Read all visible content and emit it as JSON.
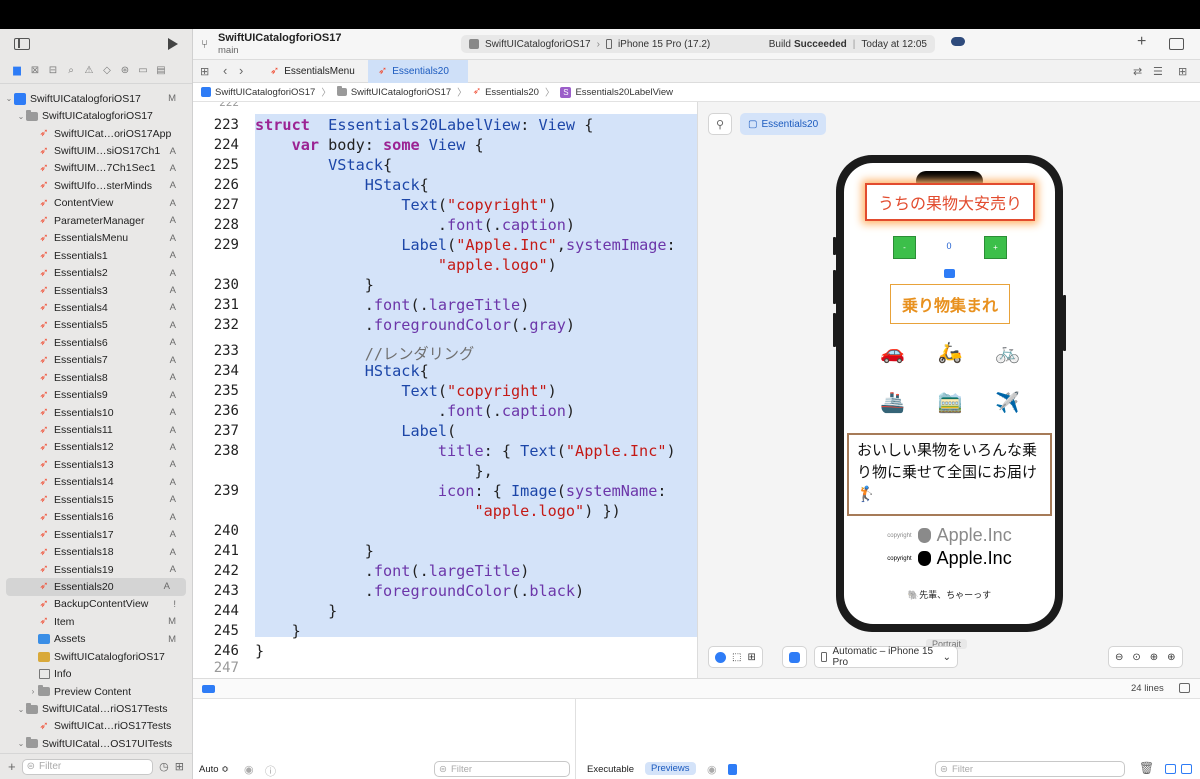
{
  "project": {
    "name": "SwiftUICatalogforiOS17",
    "branch": "main"
  },
  "toolbar": {
    "scheme": "SwiftUICatalogforiOS17",
    "device": "iPhone 15 Pro (17.2)",
    "build_prefix": "Build",
    "build_status": "Succeeded",
    "build_time": "Today at 12:05"
  },
  "tabs": [
    {
      "label": "EssentialsMenu"
    },
    {
      "label": "Essentials20"
    }
  ],
  "jumpbar": [
    "SwiftUICatalogforiOS17",
    "SwiftUICatalogforiOS17",
    "Essentials20",
    "Essentials20LabelView"
  ],
  "navigator": {
    "rows": [
      {
        "label": "SwiftUICatalogforiOS17",
        "status": "M",
        "kind": "project",
        "indent": 0,
        "open": true
      },
      {
        "label": "SwiftUICatalogforiOS17",
        "status": "",
        "kind": "folder",
        "indent": 1,
        "open": true
      },
      {
        "label": "SwiftUICat…oriOS17App",
        "status": "",
        "kind": "swift",
        "indent": 2
      },
      {
        "label": "SwiftUIM…siOS17Ch1",
        "status": "A",
        "kind": "swift",
        "indent": 2
      },
      {
        "label": "SwiftUIM…7Ch1Sec1",
        "status": "A",
        "kind": "swift",
        "indent": 2
      },
      {
        "label": "SwiftUIfo…sterMinds",
        "status": "A",
        "kind": "swift",
        "indent": 2
      },
      {
        "label": "ContentView",
        "status": "A",
        "kind": "swift",
        "indent": 2
      },
      {
        "label": "ParameterManager",
        "status": "A",
        "kind": "swift",
        "indent": 2
      },
      {
        "label": "EssentialsMenu",
        "status": "A",
        "kind": "swift",
        "indent": 2
      },
      {
        "label": "Essentials1",
        "status": "A",
        "kind": "swift",
        "indent": 2
      },
      {
        "label": "Essentials2",
        "status": "A",
        "kind": "swift",
        "indent": 2
      },
      {
        "label": "Essentials3",
        "status": "A",
        "kind": "swift",
        "indent": 2
      },
      {
        "label": "Essentials4",
        "status": "A",
        "kind": "swift",
        "indent": 2
      },
      {
        "label": "Essentials5",
        "status": "A",
        "kind": "swift",
        "indent": 2
      },
      {
        "label": "Essentials6",
        "status": "A",
        "kind": "swift",
        "indent": 2
      },
      {
        "label": "Essentials7",
        "status": "A",
        "kind": "swift",
        "indent": 2
      },
      {
        "label": "Essentials8",
        "status": "A",
        "kind": "swift",
        "indent": 2
      },
      {
        "label": "Essentials9",
        "status": "A",
        "kind": "swift",
        "indent": 2
      },
      {
        "label": "Essentials10",
        "status": "A",
        "kind": "swift",
        "indent": 2
      },
      {
        "label": "Essentials11",
        "status": "A",
        "kind": "swift",
        "indent": 2
      },
      {
        "label": "Essentials12",
        "status": "A",
        "kind": "swift",
        "indent": 2
      },
      {
        "label": "Essentials13",
        "status": "A",
        "kind": "swift",
        "indent": 2
      },
      {
        "label": "Essentials14",
        "status": "A",
        "kind": "swift",
        "indent": 2
      },
      {
        "label": "Essentials15",
        "status": "A",
        "kind": "swift",
        "indent": 2
      },
      {
        "label": "Essentials16",
        "status": "A",
        "kind": "swift",
        "indent": 2
      },
      {
        "label": "Essentials17",
        "status": "A",
        "kind": "swift",
        "indent": 2
      },
      {
        "label": "Essentials18",
        "status": "A",
        "kind": "swift",
        "indent": 2
      },
      {
        "label": "Essentials19",
        "status": "A",
        "kind": "swift",
        "indent": 2
      },
      {
        "label": "Essentials20",
        "status": "A",
        "kind": "swift",
        "indent": 2,
        "selected": true
      },
      {
        "label": "BackupContentView",
        "status": "!",
        "kind": "swift",
        "indent": 2
      },
      {
        "label": "Item",
        "status": "M",
        "kind": "swift",
        "indent": 2
      },
      {
        "label": "Assets",
        "status": "M",
        "kind": "assets",
        "indent": 2
      },
      {
        "label": "SwiftUICatalogforiOS17",
        "status": "",
        "kind": "entitlements",
        "indent": 2
      },
      {
        "label": "Info",
        "status": "",
        "kind": "plist",
        "indent": 2
      },
      {
        "label": "Preview Content",
        "status": "",
        "kind": "folder",
        "indent": 2,
        "open": false
      },
      {
        "label": "SwiftUICatal…riOS17Tests",
        "status": "",
        "kind": "folder",
        "indent": 1,
        "open": true
      },
      {
        "label": "SwiftUICat…riOS17Tests",
        "status": "",
        "kind": "swift",
        "indent": 2
      },
      {
        "label": "SwiftUICatal…OS17UITests",
        "status": "",
        "kind": "folder",
        "indent": 1,
        "open": true
      }
    ],
    "filter_placeholder": "Filter"
  },
  "code": {
    "partial_line": "222",
    "last_line": "247",
    "lines": [
      {
        "n": "223",
        "segs": [
          [
            "kw",
            "struct"
          ],
          [
            "",
            "  "
          ],
          [
            "ty",
            "Essentials20LabelView"
          ],
          [
            "",
            ": "
          ],
          [
            "ty",
            "View"
          ],
          [
            "",
            " {"
          ]
        ]
      },
      {
        "n": "224",
        "segs": [
          [
            "",
            "    "
          ],
          [
            "kw",
            "var"
          ],
          [
            "",
            ""
          ],
          [
            "",
            " body: "
          ],
          [
            "kw",
            "some"
          ],
          [
            "",
            " "
          ],
          [
            "ty",
            "View"
          ],
          [
            "",
            " {"
          ]
        ]
      },
      {
        "n": "225",
        "segs": [
          [
            "",
            "        "
          ],
          [
            "ty",
            "VStack"
          ],
          [
            "",
            "{"
          ]
        ]
      },
      {
        "n": "226",
        "segs": [
          [
            "",
            "            "
          ],
          [
            "ty",
            "HStack"
          ],
          [
            "",
            "{"
          ]
        ]
      },
      {
        "n": "227",
        "segs": [
          [
            "",
            "                "
          ],
          [
            "ty",
            "Text"
          ],
          [
            "",
            "("
          ],
          [
            "str",
            "\"copyright\""
          ],
          [
            "",
            ")"
          ]
        ]
      },
      {
        "n": "228",
        "segs": [
          [
            "",
            "                    ."
          ],
          [
            "fn",
            "font"
          ],
          [
            "",
            "(."
          ],
          [
            "fn",
            "caption"
          ],
          [
            "",
            ")"
          ]
        ]
      },
      {
        "n": "229",
        "segs": [
          [
            "",
            "                "
          ],
          [
            "ty",
            "Label"
          ],
          [
            "",
            "("
          ],
          [
            "str",
            "\"Apple.Inc\""
          ],
          [
            "",
            ","
          ],
          [
            "fn",
            "systemImage"
          ],
          [
            "",
            ":"
          ]
        ]
      },
      {
        "n": "",
        "segs": [
          [
            "",
            "                    "
          ],
          [
            "str",
            "\"apple.logo\""
          ],
          [
            "",
            ")"
          ]
        ]
      },
      {
        "n": "230",
        "segs": [
          [
            "",
            "            }"
          ]
        ]
      },
      {
        "n": "231",
        "segs": [
          [
            "",
            "            ."
          ],
          [
            "fn",
            "font"
          ],
          [
            "",
            "(."
          ],
          [
            "fn",
            "largeTitle"
          ],
          [
            "",
            ")"
          ]
        ]
      },
      {
        "n": "232",
        "segs": [
          [
            "",
            "            ."
          ],
          [
            "fn",
            "foregroundColor"
          ],
          [
            "",
            "(."
          ],
          [
            "fn",
            "gray"
          ],
          [
            "",
            ")"
          ]
        ]
      },
      {
        "n": "233",
        "segs": [
          [
            "cm",
            "            //レンダリング"
          ]
        ]
      },
      {
        "n": "234",
        "segs": [
          [
            "",
            "            "
          ],
          [
            "ty",
            "HStack"
          ],
          [
            "",
            "{"
          ]
        ]
      },
      {
        "n": "235",
        "segs": [
          [
            "",
            "                "
          ],
          [
            "ty",
            "Text"
          ],
          [
            "",
            "("
          ],
          [
            "str",
            "\"copyright\""
          ],
          [
            "",
            ")"
          ]
        ]
      },
      {
        "n": "236",
        "segs": [
          [
            "",
            "                    ."
          ],
          [
            "fn",
            "font"
          ],
          [
            "",
            "(."
          ],
          [
            "fn",
            "caption"
          ],
          [
            "",
            ")"
          ]
        ]
      },
      {
        "n": "237",
        "segs": [
          [
            "",
            "                "
          ],
          [
            "ty",
            "Label"
          ],
          [
            "",
            "("
          ]
        ]
      },
      {
        "n": "238",
        "segs": [
          [
            "",
            "                    "
          ],
          [
            "fn",
            "title"
          ],
          [
            "",
            ": { "
          ],
          [
            "ty",
            "Text"
          ],
          [
            "",
            "("
          ],
          [
            "str",
            "\"Apple.Inc\""
          ],
          [
            "",
            ")"
          ]
        ]
      },
      {
        "n": "",
        "segs": [
          [
            "",
            "                        },"
          ]
        ]
      },
      {
        "n": "239",
        "segs": [
          [
            "",
            "                    "
          ],
          [
            "fn",
            "icon"
          ],
          [
            "",
            ": { "
          ],
          [
            "ty",
            "Image"
          ],
          [
            "",
            "("
          ],
          [
            "fn",
            "systemName"
          ],
          [
            "",
            ":"
          ]
        ]
      },
      {
        "n": "",
        "segs": [
          [
            "",
            "                        "
          ],
          [
            "str",
            "\"apple.logo\""
          ],
          [
            "",
            ") })"
          ]
        ]
      },
      {
        "n": "240",
        "segs": [
          [
            "",
            ""
          ]
        ]
      },
      {
        "n": "241",
        "segs": [
          [
            "",
            "            }"
          ]
        ]
      },
      {
        "n": "242",
        "segs": [
          [
            "",
            "            ."
          ],
          [
            "fn",
            "font"
          ],
          [
            "",
            "(."
          ],
          [
            "fn",
            "largeTitle"
          ],
          [
            "",
            ")"
          ]
        ]
      },
      {
        "n": "243",
        "segs": [
          [
            "",
            "            ."
          ],
          [
            "fn",
            "foregroundColor"
          ],
          [
            "",
            "(."
          ],
          [
            "fn",
            "black"
          ],
          [
            "",
            ")"
          ]
        ]
      },
      {
        "n": "244",
        "segs": [
          [
            "",
            "        }"
          ]
        ]
      },
      {
        "n": "245",
        "segs": [
          [
            "",
            "    }"
          ]
        ]
      },
      {
        "n": "246",
        "segs": [
          [
            "",
            "}"
          ]
        ]
      }
    ]
  },
  "preview": {
    "chip": "Essentials20",
    "title": "うちの果物大安売り",
    "stepper": {
      "minus": "-",
      "value": "0",
      "plus": "+"
    },
    "vehicles_title": "乗り物集まれ",
    "vehicles_row1": [
      "🚗",
      "🛵",
      "🚲"
    ],
    "vehicles_row2": [
      "🚢",
      "🚞",
      "✈️"
    ],
    "message": "おいしい果物をいろんな乗り物に乗せて全国にお届け🏌️",
    "copyright_small": "copyright",
    "apple_inc": "Apple.Inc",
    "greeting": "🐘先輩、ちゃーっす",
    "portrait": "Portrait",
    "device_select": "Automatic – iPhone 15 Pro"
  },
  "statusbar": {
    "lines": "24 lines"
  },
  "debug": {
    "auto": "Auto ≎",
    "filter": "Filter",
    "executable": "Executable",
    "previews": "Previews",
    "filter2": "Filter"
  },
  "colors": {
    "selection": "#d4e3f9",
    "keyword": "#9b2393",
    "type": "#1c46a8",
    "string": "#c41a16",
    "accent": "#2e7cf6"
  }
}
